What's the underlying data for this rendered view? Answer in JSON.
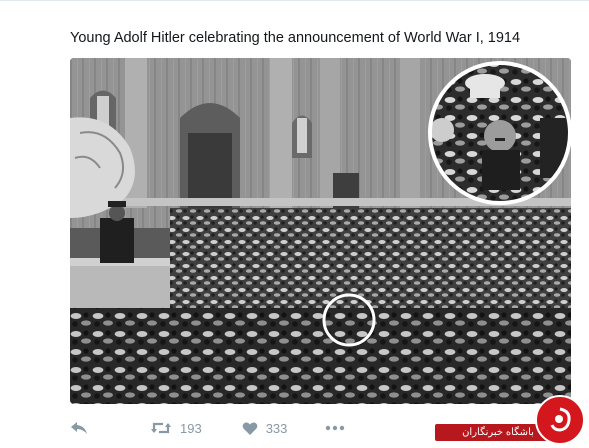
{
  "tweet": {
    "caption": "Young Adolf Hitler celebrating the announcement of World War I, 1914",
    "photo": {
      "kind": "black-and-white historical photograph",
      "highlight_circles": 2
    },
    "actions": {
      "reply_icon": "reply-icon",
      "retweet_icon": "retweet-icon",
      "retweet_count": "193",
      "like_icon": "heart-icon",
      "like_count": "333",
      "more_icon": "more-dots-icon"
    }
  },
  "watermark": {
    "text": "باشگاه خبرنگاران",
    "color": "#d4171d"
  },
  "colors": {
    "text": "#14171a",
    "icon_gray": "#8899a6",
    "border": "#e1e8ed"
  }
}
